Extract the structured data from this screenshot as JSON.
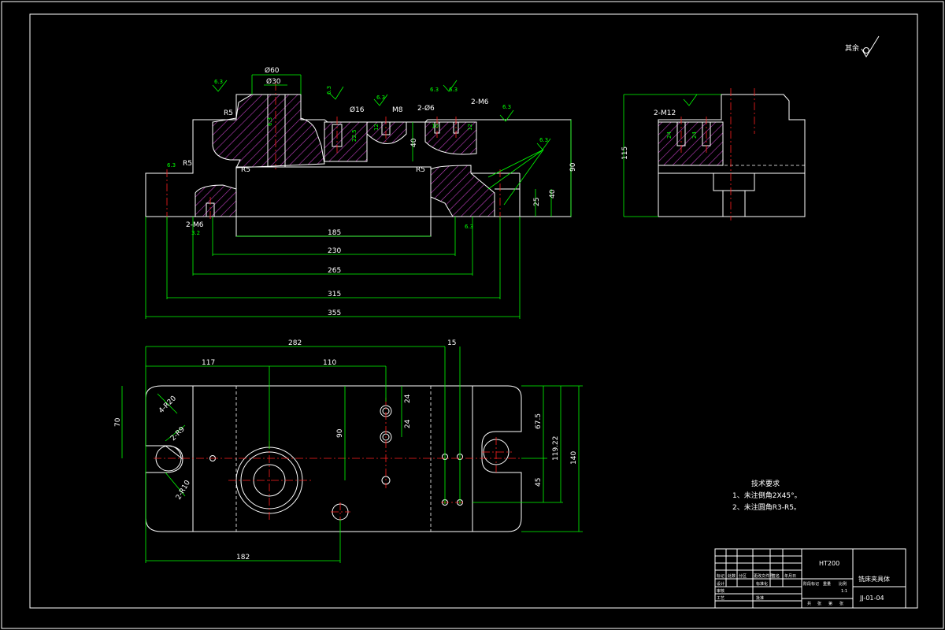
{
  "roughness_note": "其余",
  "tech_requirements": {
    "title": "技术要求",
    "line1": "1、未注倒角2X45°。",
    "line2": "2、未注圆角R3-R5。"
  },
  "title_block": {
    "material": "HT200",
    "drawing_name": "铣床夹具体",
    "drawing_no": "JJ-01-04",
    "scale": "1:1",
    "labels": [
      "标记",
      "处数",
      "分区",
      "更改文件号",
      "签名",
      "年月日",
      "设计",
      "标准化",
      "阶段标记",
      "重量",
      "比例",
      "审核",
      "工艺",
      "批准",
      "共",
      "张",
      "第",
      "张"
    ]
  },
  "front_view": {
    "dims": [
      "Ø60",
      "Ø30",
      "R5",
      "Ø16",
      "M8",
      "2-Ø6",
      "2-M6",
      "40",
      "90",
      "R5",
      "R5",
      "R5",
      "40",
      "25",
      "2-M6",
      "185",
      "230",
      "265",
      "315",
      "355",
      "22.5",
      "12",
      "12",
      "10"
    ],
    "roughness": [
      "6.3",
      "6.3",
      "6.3",
      "6.3",
      "6.3",
      "6.3",
      "6.3",
      "6.3",
      "3.2",
      "6.3",
      "6.3"
    ]
  },
  "side_view": {
    "dims": [
      "115",
      "2-M12",
      "24",
      "24"
    ]
  },
  "top_view": {
    "dims": [
      "282",
      "15",
      "117",
      "110",
      "70",
      "4-R20",
      "2-R9",
      "2-R10",
      "90",
      "24",
      "24",
      "67.5",
      "119.22",
      "140",
      "45",
      "182"
    ]
  }
}
